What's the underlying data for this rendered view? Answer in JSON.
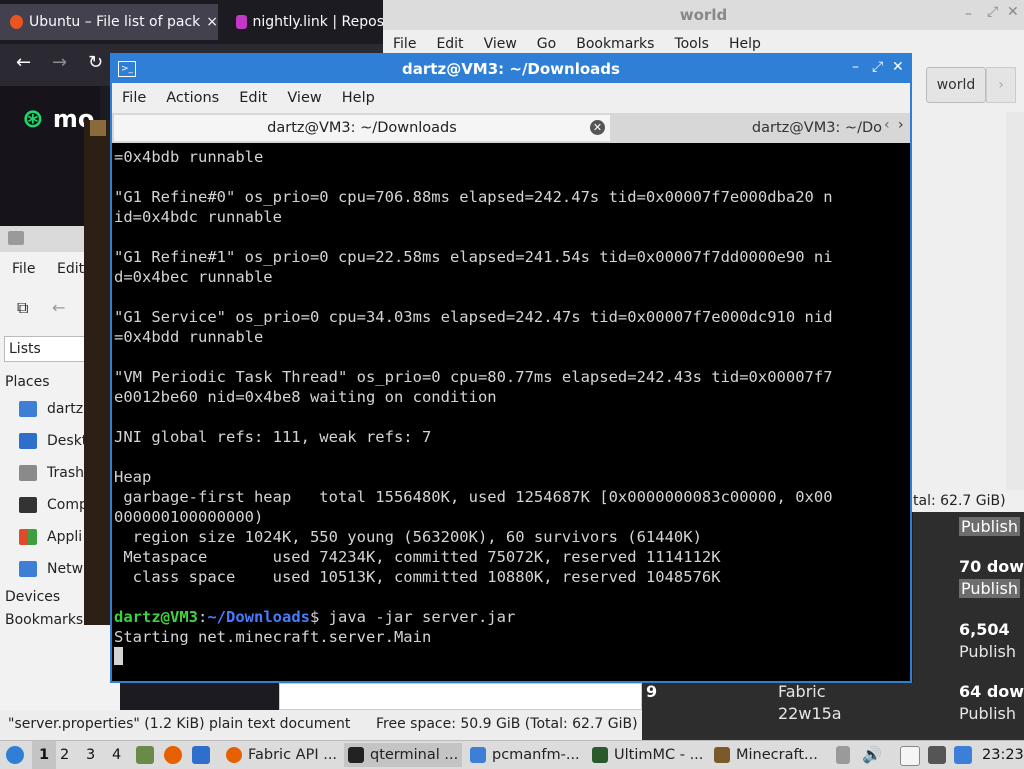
{
  "browser": {
    "tabs": [
      {
        "label": "Ubuntu – File list of pack",
        "close": "×"
      },
      {
        "label": "nightly.link | Repos"
      }
    ],
    "nav": {
      "back": "←",
      "forward": "→",
      "reload": "↻"
    },
    "site_logo": "mo",
    "right_list": [
      {
        "text": "Publish",
        "style": "pub"
      },
      {
        "text": "70 dow",
        "style": "b"
      },
      {
        "text": "Publish",
        "style": "pub"
      },
      {
        "text": "6,504",
        "style": "b"
      },
      {
        "text": "Publish",
        "style": "n"
      },
      {
        "text": "64 dow",
        "style": "b"
      },
      {
        "text": "Publish",
        "style": "n"
      }
    ],
    "bottom_row": {
      "num": "9",
      "name": "Fabric",
      "version": "22w15a"
    }
  },
  "world_window": {
    "title": "world",
    "menu": [
      "File",
      "Edit",
      "View",
      "Go",
      "Bookmarks",
      "Tools",
      "Help"
    ],
    "path_button": "world",
    "status": "tal: 62.7 GiB)"
  },
  "file_manager": {
    "menu": [
      "File",
      "Edit"
    ],
    "lists_label": "Lists",
    "places_header": "Places",
    "places": [
      {
        "label": "dartz",
        "color": "#3d7fd6"
      },
      {
        "label": "Deskt",
        "color": "#2f6fcc"
      },
      {
        "label": "Trash",
        "color": "#8a8a8a"
      },
      {
        "label": "Comp",
        "color": "#333333"
      },
      {
        "label": "Appli",
        "color": "#e04a2a"
      },
      {
        "label": "Netw",
        "color": "#3d7fd6"
      }
    ],
    "devices_header": "Devices",
    "bookmarks_header": "Bookmarks",
    "status_left": "\"server.properties\" (1.2 KiB) plain text document",
    "status_right": "Free space: 50.9 GiB (Total: 62.7 GiB)"
  },
  "terminal": {
    "title": "dartz@VM3: ~/Downloads",
    "menu": [
      "File",
      "Actions",
      "Edit",
      "View",
      "Help"
    ],
    "tabs": [
      "dartz@VM3: ~/Downloads",
      "dartz@VM3: ~/Do"
    ],
    "lines": [
      "=0x4bdb runnable",
      "",
      "\"G1 Refine#0\" os_prio=0 cpu=706.88ms elapsed=242.47s tid=0x00007f7e000dba20 n",
      "id=0x4bdc runnable",
      "",
      "\"G1 Refine#1\" os_prio=0 cpu=22.58ms elapsed=241.54s tid=0x00007f7dd0000e90 ni",
      "d=0x4bec runnable",
      "",
      "\"G1 Service\" os_prio=0 cpu=34.03ms elapsed=242.47s tid=0x00007f7e000dc910 nid",
      "=0x4bdd runnable",
      "",
      "\"VM Periodic Task Thread\" os_prio=0 cpu=80.77ms elapsed=242.43s tid=0x00007f7",
      "e0012be60 nid=0x4be8 waiting on condition",
      "",
      "JNI global refs: 111, weak refs: 7",
      "",
      "Heap",
      " garbage-first heap   total 1556480K, used 1254687K [0x0000000083c00000, 0x00",
      "000000100000000)",
      "  region size 1024K, 550 young (563200K), 60 survivors (61440K)",
      " Metaspace       used 74234K, committed 75072K, reserved 1114112K",
      "  class space    used 10513K, committed 10880K, reserved 1048576K",
      ""
    ],
    "prompt_user": "dartz@VM3",
    "prompt_sep": ":",
    "prompt_path": "~/Downloads",
    "prompt_end": "$ ",
    "command": "java -jar server.jar",
    "output": "Starting net.minecraft.server.Main"
  },
  "taskbar": {
    "workspaces": [
      "1",
      "2",
      "3",
      "4"
    ],
    "tasks": [
      {
        "label": "Fabric API ...",
        "color": "#e66000"
      },
      {
        "label": "qterminal ...",
        "color": "#222222"
      },
      {
        "label": "pcmanfm-...",
        "color": "#3d7fd6"
      },
      {
        "label": "UltimMC - ...",
        "color": "#2a5a2a"
      },
      {
        "label": "Minecraft...",
        "color": "#7a5a2a"
      }
    ],
    "clock": "23:23"
  }
}
